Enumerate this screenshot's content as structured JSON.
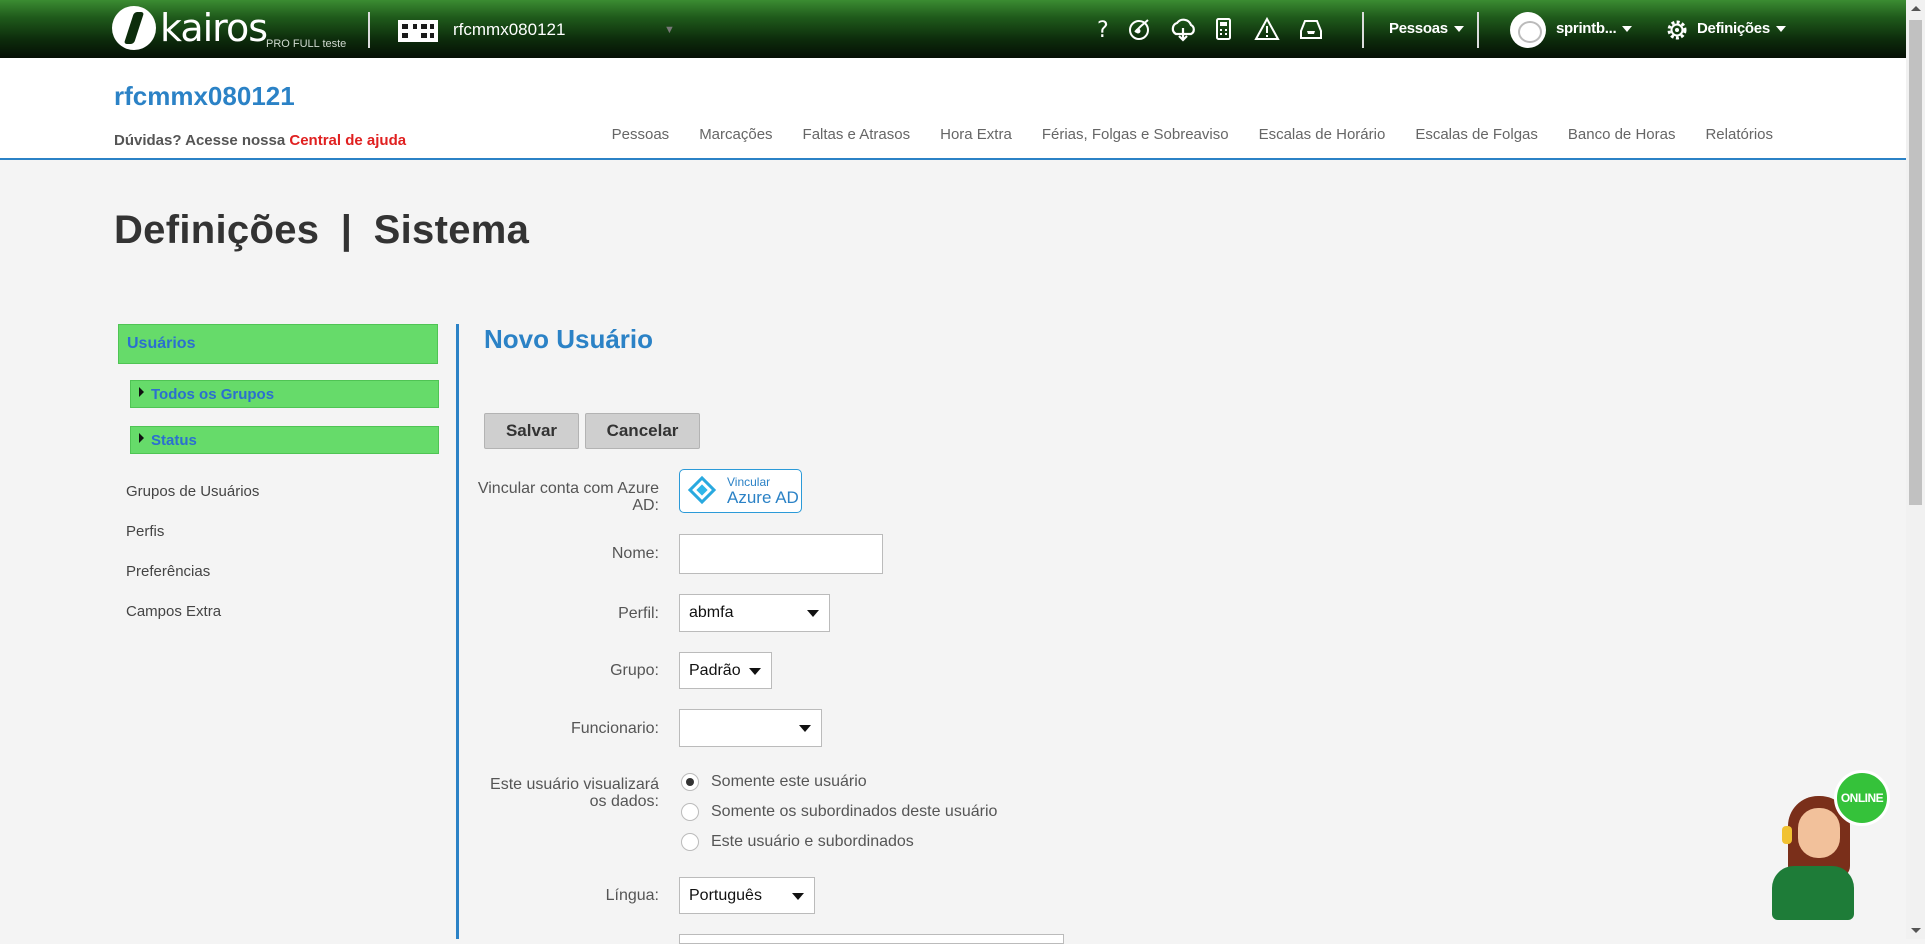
{
  "topbar": {
    "logo_text": "kairos",
    "logo_sub": "PRO FULL teste",
    "company": "rfcmmx080121",
    "menu_pessoas": "Pessoas",
    "user": "sprintb...",
    "settings": "Definições",
    "icons": [
      "help-icon",
      "whistle-icon",
      "cloud-sync-icon",
      "calculator-icon",
      "warning-icon",
      "inbox-icon"
    ]
  },
  "header": {
    "title": "rfcmmx080121",
    "help_prefix": "Dúvidas? Acesse nossa",
    "help_link": "Central de ajuda",
    "nav": [
      "Pessoas",
      "Marcações",
      "Faltas e Atrasos",
      "Hora Extra",
      "Férias, Folgas e Sobreaviso",
      "Escalas de Horário",
      "Escalas de Folgas",
      "Banco de Horas",
      "Relatórios"
    ]
  },
  "page": {
    "title": "Definições",
    "sep": "|",
    "subtitle": "Sistema"
  },
  "sidebar": {
    "active": "Usuários",
    "sub": [
      "Todos os Grupos",
      "Status"
    ],
    "links": [
      "Grupos de Usuários",
      "Perfis",
      "Preferências",
      "Campos Extra"
    ]
  },
  "form": {
    "title": "Novo Usuário",
    "save": "Salvar",
    "cancel": "Cancelar",
    "azure_label": "Vincular conta com Azure AD:",
    "azure_small": "Vincular",
    "azure_big": "Azure AD",
    "nome_label": "Nome:",
    "nome_value": "",
    "perfil_label": "Perfil:",
    "perfil_value": "abmfa",
    "grupo_label": "Grupo:",
    "grupo_value": "Padrão",
    "func_label": "Funcionario:",
    "func_value": "",
    "visual_label": "Este usuário visualizará os dados:",
    "radio_options": [
      "Somente este usuário",
      "Somente os subordinados deste usuário",
      "Este usuário e subordinados"
    ],
    "radio_selected": 0,
    "lingua_label": "Língua:",
    "lingua_value": "Português"
  },
  "support": {
    "status": "ONLINE"
  },
  "colors": {
    "accent": "#2b82c6",
    "green": "#66db6a",
    "link_red": "#e02020"
  }
}
